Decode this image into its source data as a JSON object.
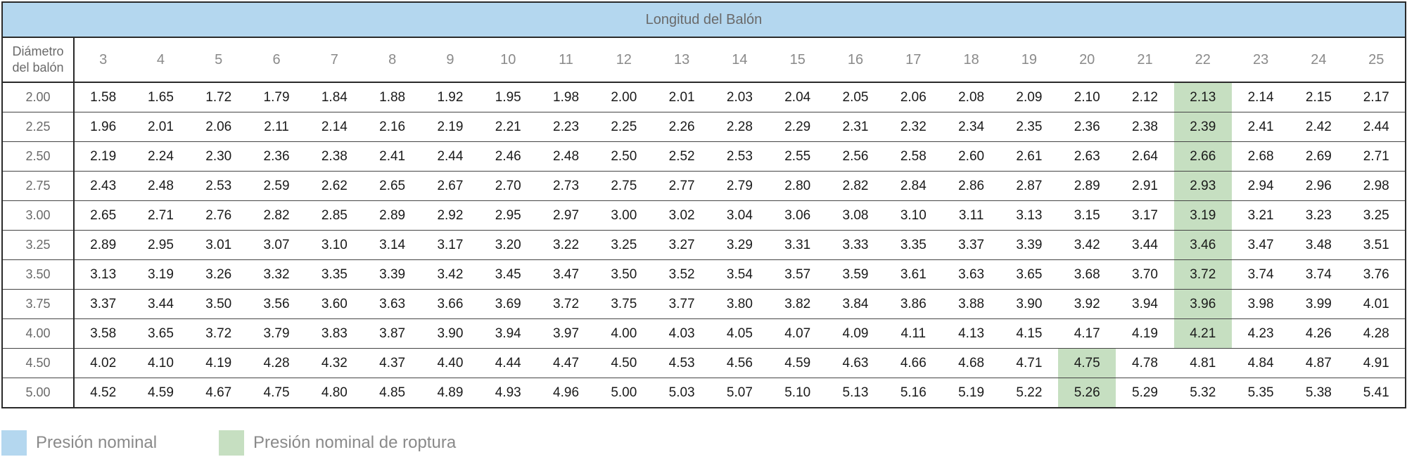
{
  "table": {
    "title": "Longitud del Balón",
    "corner_line1": "Diámetro",
    "corner_line2": "del balón",
    "columns": [
      "3",
      "4",
      "5",
      "6",
      "7",
      "8",
      "9",
      "10",
      "11",
      "12",
      "13",
      "14",
      "15",
      "16",
      "17",
      "18",
      "19",
      "20",
      "21",
      "22",
      "23",
      "24",
      "25"
    ],
    "rows": [
      {
        "diameter": "2.00",
        "values": [
          "1.58",
          "1.65",
          "1.72",
          "1.79",
          "1.84",
          "1.88",
          "1.92",
          "1.95",
          "1.98",
          "2.00",
          "2.01",
          "2.03",
          "2.04",
          "2.05",
          "2.06",
          "2.08",
          "2.09",
          "2.10",
          "2.12",
          "2.13",
          "2.14",
          "2.15",
          "2.17"
        ],
        "highlight_column": "22"
      },
      {
        "diameter": "2.25",
        "values": [
          "1.96",
          "2.01",
          "2.06",
          "2.11",
          "2.14",
          "2.16",
          "2.19",
          "2.21",
          "2.23",
          "2.25",
          "2.26",
          "2.28",
          "2.29",
          "2.31",
          "2.32",
          "2.34",
          "2.35",
          "2.36",
          "2.38",
          "2.39",
          "2.41",
          "2.42",
          "2.44"
        ],
        "highlight_column": "22"
      },
      {
        "diameter": "2.50",
        "values": [
          "2.19",
          "2.24",
          "2.30",
          "2.36",
          "2.38",
          "2.41",
          "2.44",
          "2.46",
          "2.48",
          "2.50",
          "2.52",
          "2.53",
          "2.55",
          "2.56",
          "2.58",
          "2.60",
          "2.61",
          "2.63",
          "2.64",
          "2.66",
          "2.68",
          "2.69",
          "2.71"
        ],
        "highlight_column": "22"
      },
      {
        "diameter": "2.75",
        "values": [
          "2.43",
          "2.48",
          "2.53",
          "2.59",
          "2.62",
          "2.65",
          "2.67",
          "2.70",
          "2.73",
          "2.75",
          "2.77",
          "2.79",
          "2.80",
          "2.82",
          "2.84",
          "2.86",
          "2.87",
          "2.89",
          "2.91",
          "2.93",
          "2.94",
          "2.96",
          "2.98"
        ],
        "highlight_column": "22"
      },
      {
        "diameter": "3.00",
        "values": [
          "2.65",
          "2.71",
          "2.76",
          "2.82",
          "2.85",
          "2.89",
          "2.92",
          "2.95",
          "2.97",
          "3.00",
          "3.02",
          "3.04",
          "3.06",
          "3.08",
          "3.10",
          "3.11",
          "3.13",
          "3.15",
          "3.17",
          "3.19",
          "3.21",
          "3.23",
          "3.25"
        ],
        "highlight_column": "22"
      },
      {
        "diameter": "3.25",
        "values": [
          "2.89",
          "2.95",
          "3.01",
          "3.07",
          "3.10",
          "3.14",
          "3.17",
          "3.20",
          "3.22",
          "3.25",
          "3.27",
          "3.29",
          "3.31",
          "3.33",
          "3.35",
          "3.37",
          "3.39",
          "3.42",
          "3.44",
          "3.46",
          "3.47",
          "3.48",
          "3.51"
        ],
        "highlight_column": "22"
      },
      {
        "diameter": "3.50",
        "values": [
          "3.13",
          "3.19",
          "3.26",
          "3.32",
          "3.35",
          "3.39",
          "3.42",
          "3.45",
          "3.47",
          "3.50",
          "3.52",
          "3.54",
          "3.57",
          "3.59",
          "3.61",
          "3.63",
          "3.65",
          "3.68",
          "3.70",
          "3.72",
          "3.74",
          "3.74",
          "3.76"
        ],
        "highlight_column": "22"
      },
      {
        "diameter": "3.75",
        "values": [
          "3.37",
          "3.44",
          "3.50",
          "3.56",
          "3.60",
          "3.63",
          "3.66",
          "3.69",
          "3.72",
          "3.75",
          "3.77",
          "3.80",
          "3.82",
          "3.84",
          "3.86",
          "3.88",
          "3.90",
          "3.92",
          "3.94",
          "3.96",
          "3.98",
          "3.99",
          "4.01"
        ],
        "highlight_column": "22"
      },
      {
        "diameter": "4.00",
        "values": [
          "3.58",
          "3.65",
          "3.72",
          "3.79",
          "3.83",
          "3.87",
          "3.90",
          "3.94",
          "3.97",
          "4.00",
          "4.03",
          "4.05",
          "4.07",
          "4.09",
          "4.11",
          "4.13",
          "4.15",
          "4.17",
          "4.19",
          "4.21",
          "4.23",
          "4.26",
          "4.28"
        ],
        "highlight_column": "22"
      },
      {
        "diameter": "4.50",
        "values": [
          "4.02",
          "4.10",
          "4.19",
          "4.28",
          "4.32",
          "4.37",
          "4.40",
          "4.44",
          "4.47",
          "4.50",
          "4.53",
          "4.56",
          "4.59",
          "4.63",
          "4.66",
          "4.68",
          "4.71",
          "4.75",
          "4.78",
          "4.81",
          "4.84",
          "4.87",
          "4.91"
        ],
        "highlight_column": "20"
      },
      {
        "diameter": "5.00",
        "values": [
          "4.52",
          "4.59",
          "4.67",
          "4.75",
          "4.80",
          "4.85",
          "4.89",
          "4.93",
          "4.96",
          "5.00",
          "5.03",
          "5.07",
          "5.10",
          "5.13",
          "5.16",
          "5.19",
          "5.22",
          "5.26",
          "5.29",
          "5.32",
          "5.35",
          "5.38",
          "5.41"
        ],
        "highlight_column": "20"
      }
    ]
  },
  "legend": {
    "nominal_label": "Presión nominal",
    "nominal_color": "#b4d7ef",
    "rupture_label": "Presión nominal de roptura",
    "rupture_color": "#c6dfc1"
  }
}
